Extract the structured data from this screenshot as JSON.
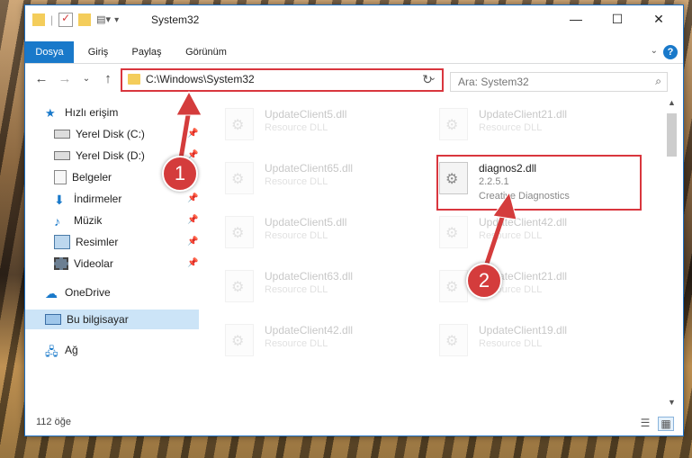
{
  "window": {
    "title": "System32"
  },
  "title_controls": {
    "minimize": "—",
    "maximize": "☐",
    "close": "✕"
  },
  "ribbon": {
    "tabs": [
      {
        "label": "Dosya",
        "active": true
      },
      {
        "label": "Giriş"
      },
      {
        "label": "Paylaş"
      },
      {
        "label": "Görünüm"
      }
    ],
    "help": "?"
  },
  "navigation": {
    "address": "C:\\Windows\\System32",
    "search_placeholder": "Ara: System32"
  },
  "sidebar": {
    "items": [
      {
        "label": "Hızlı erişim",
        "icon": "star-icon"
      },
      {
        "label": "Yerel Disk (C:)",
        "icon": "drive-icon",
        "pinned": true
      },
      {
        "label": "Yerel Disk (D:)",
        "icon": "drive-icon",
        "pinned": true
      },
      {
        "label": "Belgeler",
        "icon": "documents-icon",
        "pinned": true
      },
      {
        "label": "İndirmeler",
        "icon": "download-icon",
        "pinned": true
      },
      {
        "label": "Müzik",
        "icon": "music-icon",
        "pinned": true
      },
      {
        "label": "Resimler",
        "icon": "pictures-icon",
        "pinned": true
      },
      {
        "label": "Videolar",
        "icon": "videos-icon",
        "pinned": true
      },
      {
        "label": "OneDrive",
        "icon": "cloud-icon"
      },
      {
        "label": "Bu bilgisayar",
        "icon": "computer-icon",
        "selected": true
      },
      {
        "label": "Ağ",
        "icon": "network-icon"
      }
    ]
  },
  "files": {
    "left_column": [
      {
        "name": "UpdateClient5.dll",
        "desc": "Resource DLL"
      },
      {
        "name": "UpdateClient65.dll",
        "desc": "Resource DLL"
      },
      {
        "name": "UpdateClient5.dll",
        "desc": "Resource DLL"
      },
      {
        "name": "UpdateClient63.dll",
        "desc": "Resource DLL"
      },
      {
        "name": "UpdateClient42.dll",
        "desc": "Resource DLL"
      }
    ],
    "right_column": [
      {
        "name": "UpdateClient21.dll",
        "desc": "Resource DLL"
      },
      {
        "name": "UpdateClient42.dll",
        "desc": "Resource DLL"
      },
      {
        "name": "UpdateClient21.dll",
        "desc": "Resource DLL"
      },
      {
        "name": "UpdateClient19.dll",
        "desc": "Resource DLL"
      }
    ],
    "highlighted": {
      "name": "diagnos2.dll",
      "version": "2.2.5.1",
      "company": "Creative Diagnostics"
    }
  },
  "status": {
    "count": "112 öğe"
  },
  "annotations": {
    "badge1": "1",
    "badge2": "2"
  },
  "colors": {
    "accent": "#1979ca",
    "highlight": "#d9363e"
  }
}
